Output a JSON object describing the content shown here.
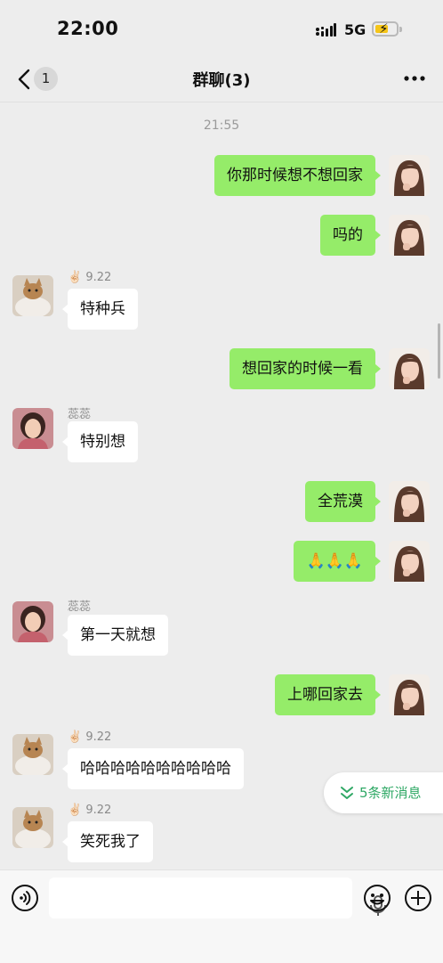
{
  "status_bar": {
    "time": "22:00",
    "network": "5G"
  },
  "nav": {
    "back_count": "1",
    "title": "群聊(3)"
  },
  "timestamp": "21:55",
  "messages": [
    {
      "side": "me",
      "text": "你那时候想不想回家"
    },
    {
      "side": "me",
      "text": "吗的"
    },
    {
      "side": "other",
      "sender": "9.22",
      "text": "特种兵"
    },
    {
      "side": "me",
      "text": "想回家的时候一看"
    },
    {
      "side": "other",
      "sender": "蕊蕊",
      "text": "特别想"
    },
    {
      "side": "me",
      "text": "全荒漠"
    },
    {
      "side": "me",
      "text": "🙏🙏🙏"
    },
    {
      "side": "other",
      "sender": "蕊蕊",
      "text": "第一天就想"
    },
    {
      "side": "me",
      "text": "上哪回家去"
    },
    {
      "side": "other",
      "sender": "9.22",
      "text": "哈哈哈哈哈哈哈哈哈哈"
    },
    {
      "side": "other",
      "sender": "9.22",
      "text": "笑死我了"
    }
  ],
  "new_messages_label": "5条新消息",
  "icons": {
    "back": "chevron-left-icon",
    "more": "more-dots-icon",
    "voice": "voice-icon",
    "mic": "mic-icon",
    "emoji": "emoji-icon",
    "plus": "plus-icon"
  },
  "colors": {
    "my_bubble": "#95ec69",
    "other_bubble": "#ffffff",
    "background": "#ededed",
    "new_msg_text": "#2fa865"
  }
}
